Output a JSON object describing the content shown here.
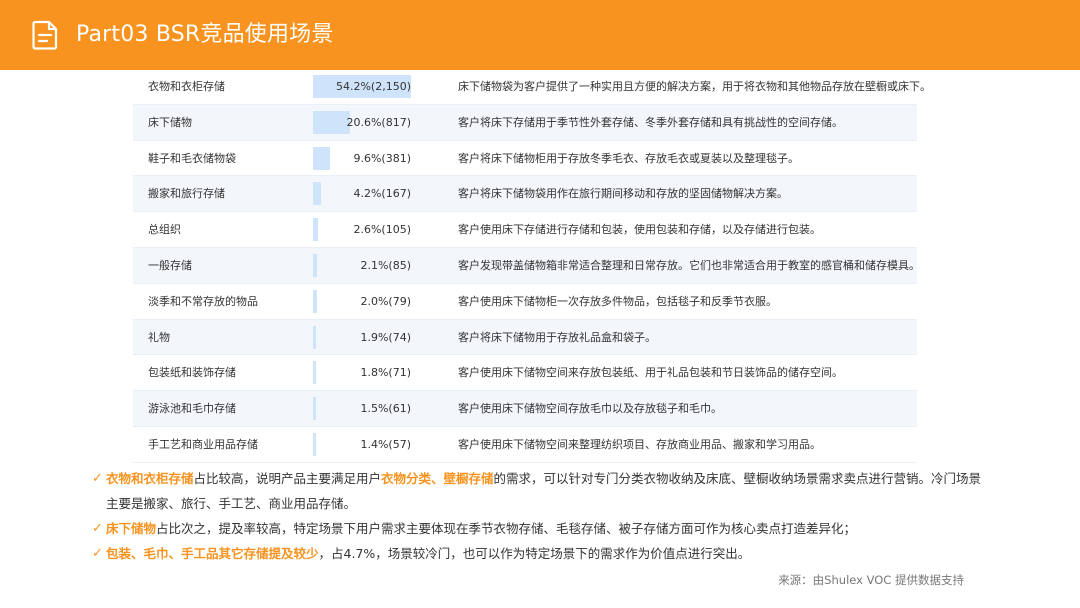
{
  "header": {
    "title": "Part03 BSR竞品使用场景",
    "icon": "document-icon",
    "color": "#f7931e"
  },
  "table": {
    "rows": [
      {
        "name": "衣物和衣柜存储",
        "value": "54.2%(2,150)",
        "share": 54.2,
        "desc": "床下储物袋为客户提供了一种实用且方便的解决方案，用于将衣物和其他物品存放在壁橱或床下。"
      },
      {
        "name": "床下储物",
        "value": "20.6%(817)",
        "share": 20.6,
        "desc": "客户将床下存储用于季节性外套存储、冬季外套存储和具有挑战性的空间存储。"
      },
      {
        "name": "鞋子和毛衣储物袋",
        "value": "9.6%(381)",
        "share": 9.6,
        "desc": "客户将床下储物柜用于存放冬季毛衣、存放毛衣或夏装以及整理毯子。"
      },
      {
        "name": "搬家和旅行存储",
        "value": "4.2%(167)",
        "share": 4.2,
        "desc": "客户将床下储物袋用作在旅行期间移动和存放的坚固储物解决方案。"
      },
      {
        "name": "总组织",
        "value": "2.6%(105)",
        "share": 2.6,
        "desc": "客户使用床下存储进行存储和包装，使用包装和存储，以及存储进行包装。"
      },
      {
        "name": "一般存储",
        "value": "2.1%(85)",
        "share": 2.1,
        "desc": "客户发现带盖储物箱非常适合整理和日常存放。它们也非常适合用于教室的感官桶和储存模具。"
      },
      {
        "name": "淡季和不常存放的物品",
        "value": "2.0%(79)",
        "share": 2.0,
        "desc": "客户使用床下储物柜一次存放多件物品，包括毯子和反季节衣服。"
      },
      {
        "name": "礼物",
        "value": "1.9%(74)",
        "share": 1.9,
        "desc": "客户将床下储物用于存放礼品盒和袋子。"
      },
      {
        "name": "包装纸和装饰存储",
        "value": "1.8%(71)",
        "share": 1.8,
        "desc": "客户使用床下储物空间来存放包装纸、用于礼品包装和节日装饰品的储存空间。"
      },
      {
        "name": "游泳池和毛巾存储",
        "value": "1.5%(61)",
        "share": 1.5,
        "desc": "客户使用床下储物空间存放毛巾以及存放毯子和毛巾。"
      },
      {
        "name": "手工艺和商业用品存储",
        "value": "1.4%(57)",
        "share": 1.4,
        "desc": "客户使用床下储物空间来整理纺织项目、存放商业用品、搬家和学习用品。"
      }
    ]
  },
  "notes": [
    {
      "segments": [
        {
          "text": "衣物和衣柜存储",
          "hl": true
        },
        {
          "text": "占比较高，说明产品主要满足用户",
          "hl": false
        },
        {
          "text": "衣物分类、壁橱存储",
          "hl": true
        },
        {
          "text": "的需求，可以针对专门分类衣物收纳及床底、壁橱收纳场景需求卖点进行营销。冷门场景主要是搬家、旅行、手工艺、商业用品存储。",
          "hl": false
        }
      ]
    },
    {
      "segments": [
        {
          "text": "床下储物",
          "hl": true
        },
        {
          "text": "占比次之，提及率较高，特定场景下用户需求主要体现在季节衣物存储、毛毯存储、被子存储方面可作为核心卖点打造差异化；",
          "hl": false
        }
      ]
    },
    {
      "segments": [
        {
          "text": "包装、毛巾、手工品其它存储提及较少",
          "hl": true
        },
        {
          "text": "，占4.7%，场景较冷门，也可以作为特定场景下的需求作为价值点进行突出。",
          "hl": false
        }
      ]
    }
  ],
  "check_icon": "checkmark-icon",
  "source": "来源：由Shulex VOC 提供数据支持",
  "colors": {
    "accent": "#f7931e",
    "bar": "#cfe4fb",
    "row_alt": "#f3f6fa"
  }
}
